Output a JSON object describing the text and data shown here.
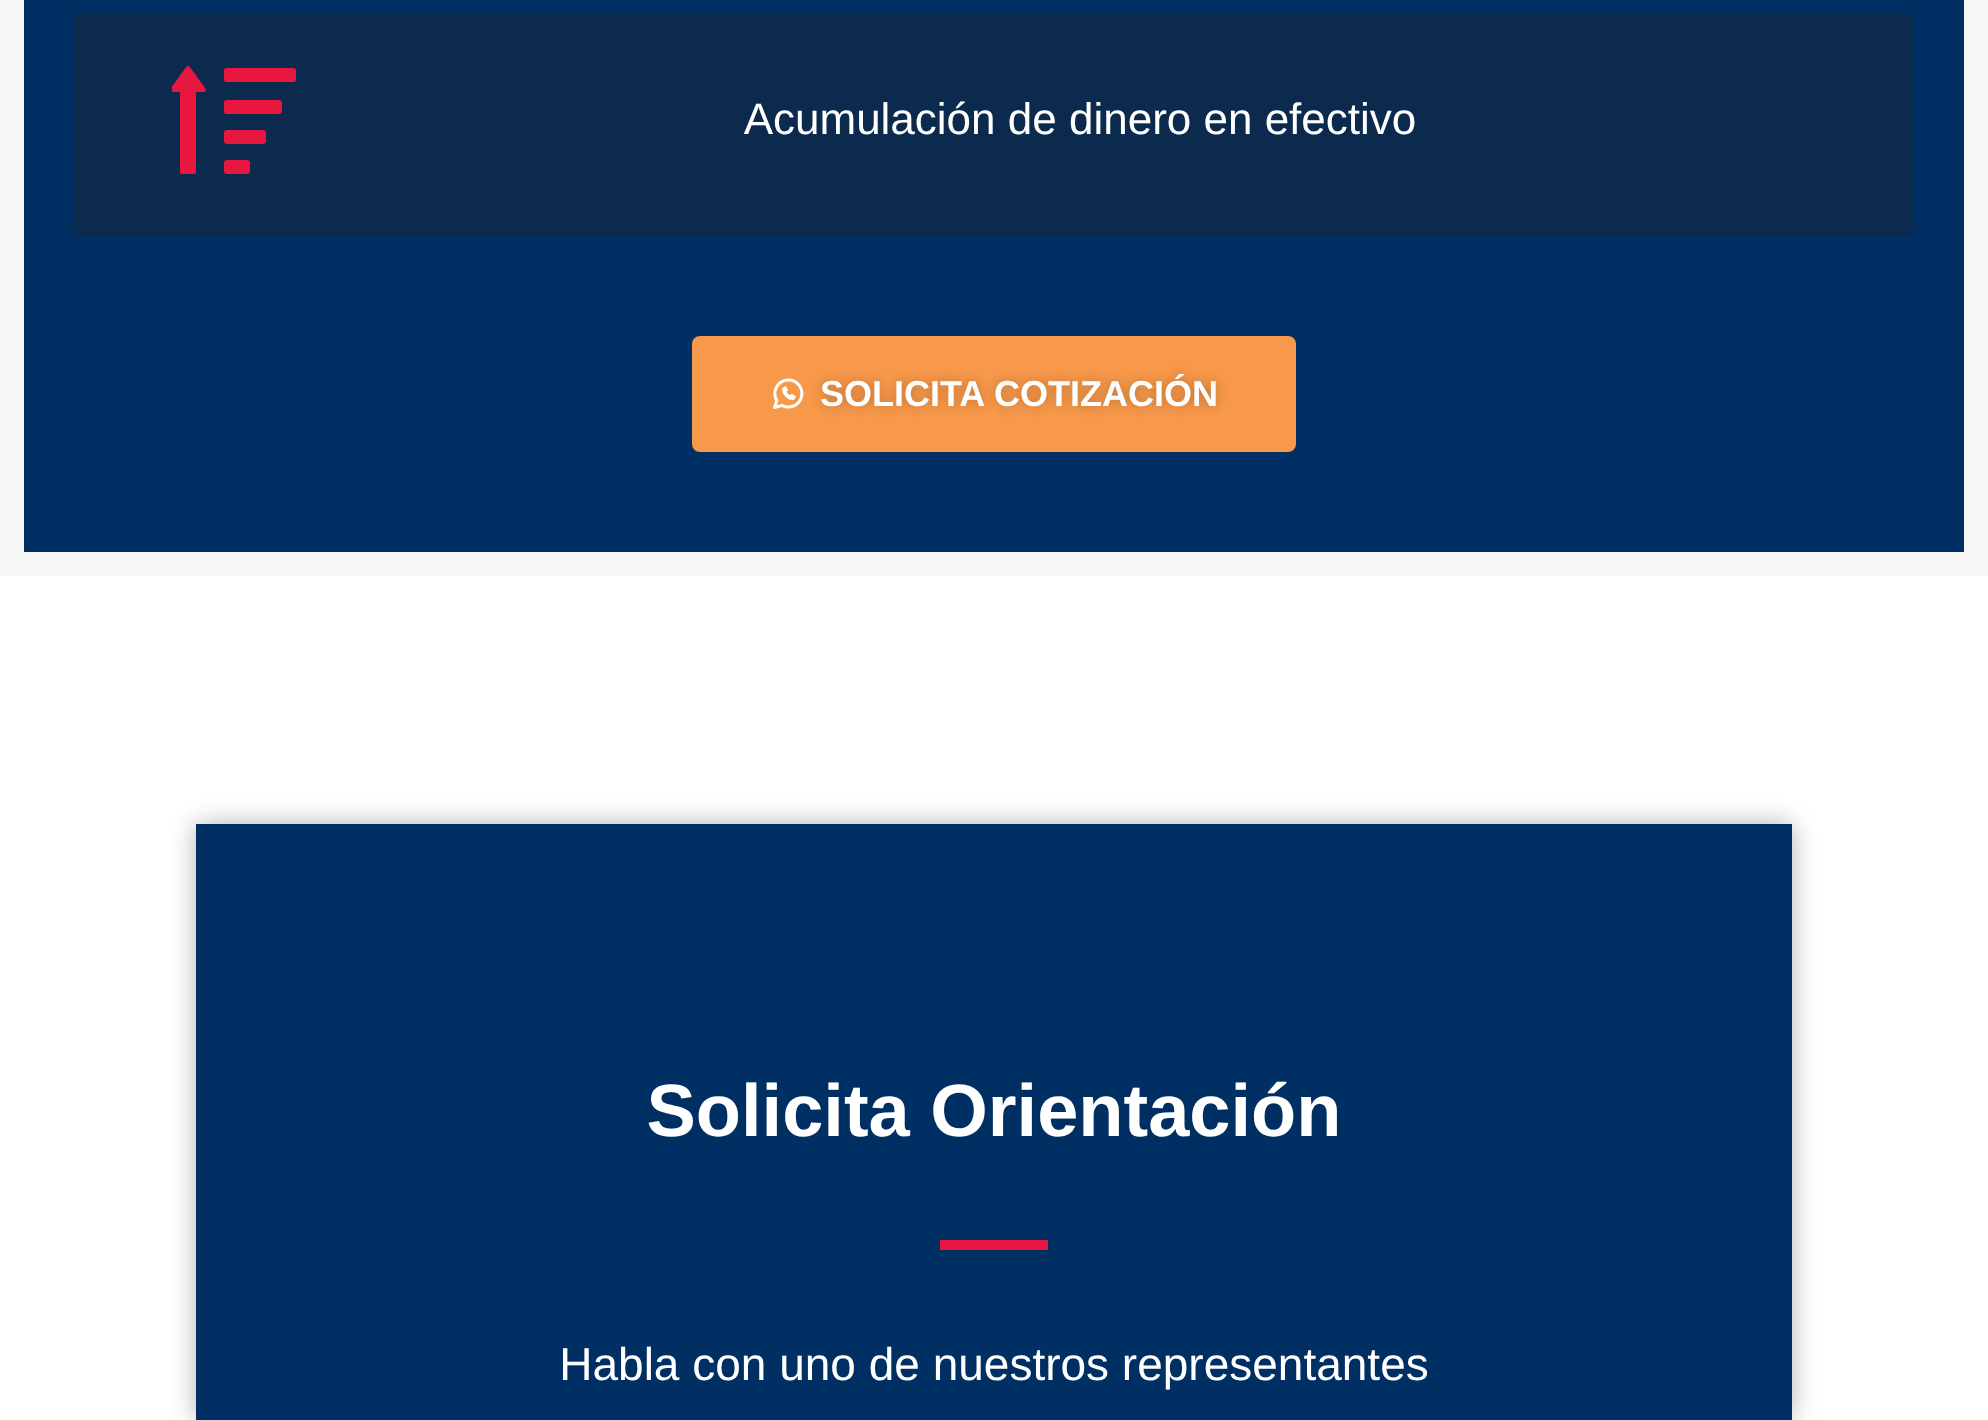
{
  "benefits": [
    {
      "label": "Acumulación de dinero en efectivo"
    }
  ],
  "quote_button": {
    "label": "SOLICITA COTIZACIÓN"
  },
  "guidance_card": {
    "title": "Solicita Orientación",
    "subtitle": "Habla con uno de nuestros representantes"
  }
}
